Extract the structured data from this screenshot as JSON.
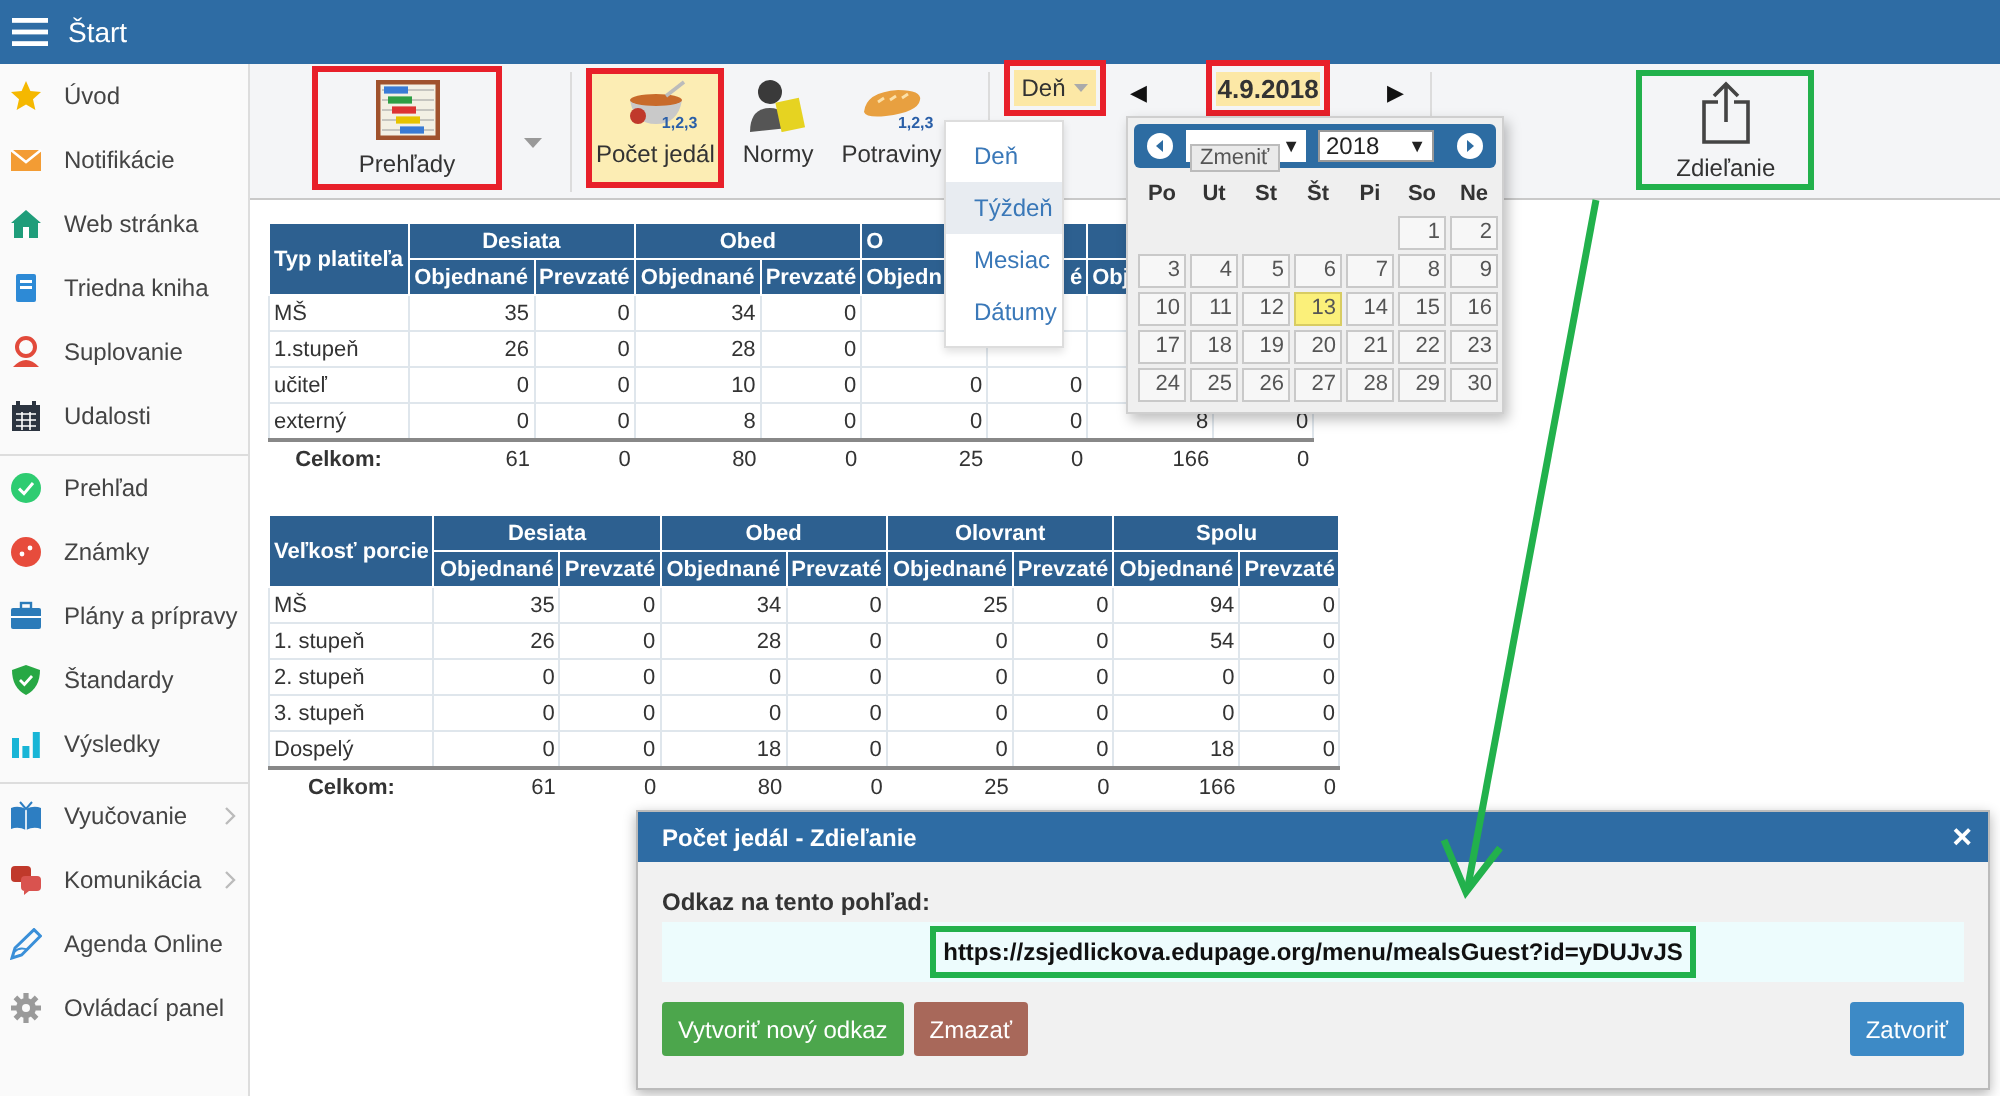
{
  "topbar": {
    "title": "Štart"
  },
  "sidebar": {
    "groups": [
      [
        {
          "label": "Úvod",
          "expandable": false
        },
        {
          "label": "Notifikácie",
          "expandable": false
        },
        {
          "label": "Web stránka",
          "expandable": false
        },
        {
          "label": "Triedna kniha",
          "expandable": false
        },
        {
          "label": "Suplovanie",
          "expandable": false
        },
        {
          "label": "Udalosti",
          "expandable": false
        }
      ],
      [
        {
          "label": "Prehľad",
          "expandable": false
        },
        {
          "label": "Známky",
          "expandable": false
        },
        {
          "label": "Plány a prípravy",
          "expandable": false
        },
        {
          "label": "Štandardy",
          "expandable": false
        },
        {
          "label": "Výsledky",
          "expandable": false
        }
      ],
      [
        {
          "label": "Vyučovanie",
          "expandable": true
        },
        {
          "label": "Komunikácia",
          "expandable": true
        },
        {
          "label": "Agenda Online",
          "expandable": false
        },
        {
          "label": "Ovládací panel",
          "expandable": false
        }
      ]
    ]
  },
  "toolbar": {
    "reports": {
      "label": "Prehľady",
      "framed": true,
      "color": "#e8202a"
    },
    "views": [
      {
        "label": "Počet jedál",
        "badge": "1,2,3",
        "selected": true,
        "framed": true,
        "color": "#e8202a"
      },
      {
        "label": "Normy",
        "selected": false,
        "framed": false
      },
      {
        "label": "Potraviny",
        "badge": "1,2,3",
        "selected": false,
        "framed": false
      }
    ],
    "period": {
      "value": "Deň",
      "framed": true,
      "color": "#e8202a"
    },
    "prev": "◀",
    "date": {
      "value": "4.9.2018",
      "framed": true,
      "color": "#e8202a"
    },
    "next": "▶",
    "share": {
      "label": "Zdieľanie",
      "framed": true,
      "color": "#22b14c"
    }
  },
  "period_menu": [
    {
      "label": "Deň",
      "highlighted": false
    },
    {
      "label": "Týždeň",
      "highlighted": true
    },
    {
      "label": "Mesiac",
      "highlighted": false
    },
    {
      "label": "Dátumy",
      "highlighted": false
    }
  ],
  "calendar": {
    "month_select": {
      "arrow": "▼"
    },
    "year_select": {
      "value": "2018",
      "arrow": "▼"
    },
    "tooltip": "Zmeniť",
    "weekdays": [
      "Po",
      "Ut",
      "St",
      "Št",
      "Pi",
      "So",
      "Ne"
    ],
    "weeks": [
      [
        {
          "day": "1",
          "selected": false
        },
        {
          "day": "2",
          "selected": false
        }
      ],
      [
        {
          "day": "3",
          "selected": false
        },
        {
          "day": "4",
          "selected": false
        },
        {
          "day": "5",
          "selected": false
        },
        {
          "day": "6",
          "selected": false
        },
        {
          "day": "7",
          "selected": false
        },
        {
          "day": "8",
          "selected": false
        },
        {
          "day": "9",
          "selected": false
        }
      ],
      [
        {
          "day": "10",
          "selected": false
        },
        {
          "day": "11",
          "selected": false
        },
        {
          "day": "12",
          "selected": false
        },
        {
          "day": "13",
          "selected": true
        },
        {
          "day": "14",
          "selected": false
        },
        {
          "day": "15",
          "selected": false
        },
        {
          "day": "16",
          "selected": false
        }
      ],
      [
        {
          "day": "17",
          "selected": false
        },
        {
          "day": "18",
          "selected": false
        },
        {
          "day": "19",
          "selected": false
        },
        {
          "day": "20",
          "selected": false
        },
        {
          "day": "21",
          "selected": false
        },
        {
          "day": "22",
          "selected": false
        },
        {
          "day": "23",
          "selected": false
        }
      ],
      [
        {
          "day": "24",
          "selected": false
        },
        {
          "day": "25",
          "selected": false
        },
        {
          "day": "26",
          "selected": false
        },
        {
          "day": "27",
          "selected": false
        },
        {
          "day": "28",
          "selected": false
        },
        {
          "day": "29",
          "selected": false
        },
        {
          "day": "30",
          "selected": false
        }
      ]
    ]
  },
  "tables": [
    {
      "row_header": "Typ platiteľa",
      "groups": [
        {
          "text": "Desiata"
        },
        {
          "text": "Obed"
        },
        {
          "text": "O"
        }
      ],
      "subheaders": [
        {
          "text": "Objednané"
        },
        {
          "text": "Prevzaté"
        },
        {
          "text": "Objednané"
        },
        {
          "text": "Prevzaté"
        },
        {
          "text": "Objedn"
        },
        {
          "text": "é"
        },
        {
          "text": "Obj"
        }
      ],
      "rows": [
        {
          "label": "MŠ",
          "cells": [
            "35",
            "0",
            "34",
            "0"
          ]
        },
        {
          "label": "1.stupeň",
          "cells": [
            "26",
            "0",
            "28",
            "0"
          ]
        },
        {
          "label": "učiteľ",
          "cells": [
            "0",
            "0",
            "10",
            "0",
            "0",
            "0"
          ]
        },
        {
          "label": "externý",
          "cells": [
            "0",
            "0",
            "8",
            "0",
            "0",
            "0",
            "8",
            "0"
          ]
        }
      ],
      "total": {
        "label": "Celkom:",
        "cells": [
          "61",
          "0",
          "80",
          "0",
          "25",
          "0",
          "166",
          "0"
        ]
      }
    },
    {
      "row_header": "Veľkosť porcie",
      "groups": [
        {
          "text": "Desiata"
        },
        {
          "text": "Obed"
        },
        {
          "text": "Olovrant"
        },
        {
          "text": "Spolu"
        }
      ],
      "subheaders": [
        {
          "text": "Objednané"
        },
        {
          "text": "Prevzaté"
        },
        {
          "text": "Objednané"
        },
        {
          "text": "Prevzaté"
        },
        {
          "text": "Objednané"
        },
        {
          "text": "Prevzaté"
        },
        {
          "text": "Objednané"
        },
        {
          "text": "Prevzaté"
        }
      ],
      "rows": [
        {
          "label": "MŠ",
          "cells": [
            "35",
            "0",
            "34",
            "0",
            "25",
            "0",
            "94",
            "0"
          ]
        },
        {
          "label": "1. stupeň",
          "cells": [
            "26",
            "0",
            "28",
            "0",
            "0",
            "0",
            "54",
            "0"
          ]
        },
        {
          "label": "2. stupeň",
          "cells": [
            "0",
            "0",
            "0",
            "0",
            "0",
            "0",
            "0",
            "0"
          ]
        },
        {
          "label": "3. stupeň",
          "cells": [
            "0",
            "0",
            "0",
            "0",
            "0",
            "0",
            "0",
            "0"
          ]
        },
        {
          "label": "Dospelý",
          "cells": [
            "0",
            "0",
            "18",
            "0",
            "0",
            "0",
            "18",
            "0"
          ]
        }
      ],
      "total": {
        "label": "Celkom:",
        "cells": [
          "61",
          "0",
          "80",
          "0",
          "25",
          "0",
          "166",
          "0"
        ]
      }
    }
  ],
  "dialog": {
    "title": "Počet jedál - Zdieľanie",
    "close": "×",
    "label": "Odkaz na tento pohľad:",
    "url": {
      "value": "https://zsjedlickova.edupage.org/menu/mealsGuest?id=yDUJvJS",
      "framed": true,
      "color": "#22b14c"
    },
    "buttons": [
      {
        "label": "Vytvoriť nový odkaz",
        "kind": "create"
      },
      {
        "label": "Zmazať",
        "kind": "delete"
      },
      {
        "label": "Zatvoriť",
        "kind": "close"
      }
    ]
  },
  "annotation_arrow": true
}
